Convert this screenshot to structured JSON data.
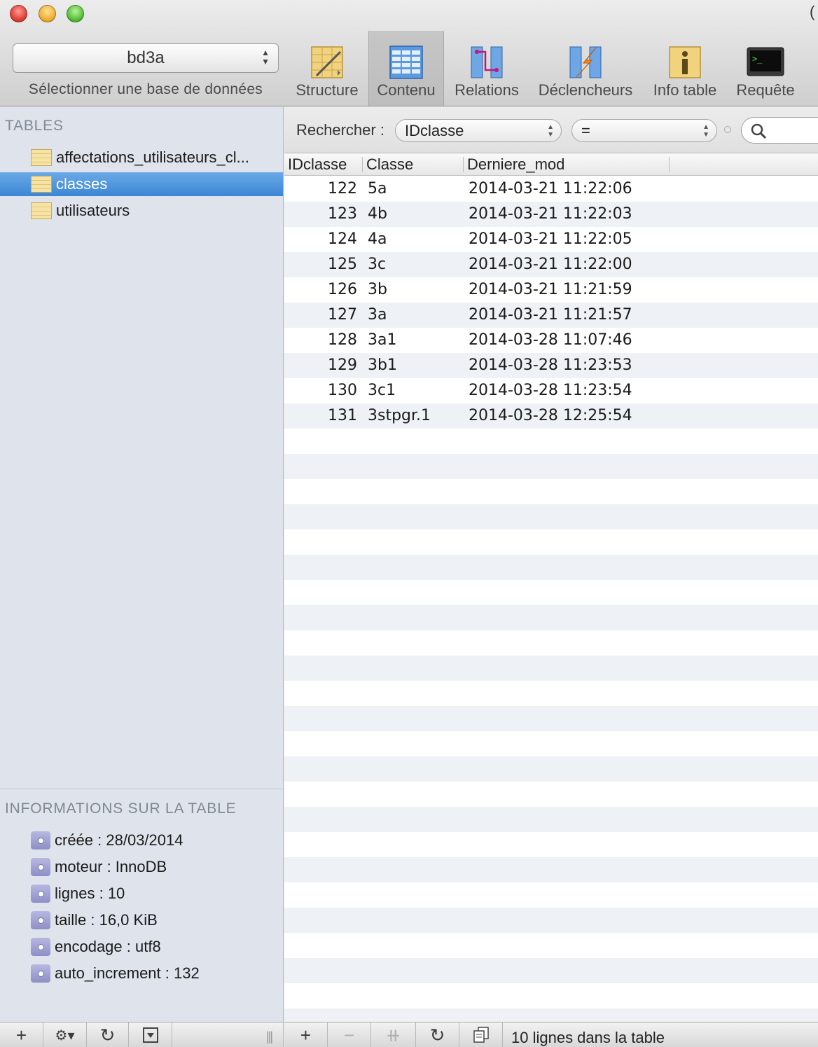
{
  "window": {
    "corner_glyph": "("
  },
  "toolbar": {
    "database_select": {
      "value": "bd3a",
      "label": "Sélectionner une base de données"
    },
    "tools": [
      {
        "label": "Structure",
        "icon": "structure-icon"
      },
      {
        "label": "Contenu",
        "icon": "content-grid-icon",
        "active": true
      },
      {
        "label": "Relations",
        "icon": "relations-icon"
      },
      {
        "label": "Déclencheurs",
        "icon": "triggers-icon"
      },
      {
        "label": "Info table",
        "icon": "info-icon"
      },
      {
        "label": "Requête",
        "icon": "terminal-icon"
      }
    ]
  },
  "sidebar": {
    "tables_title": "TABLES",
    "tables": [
      {
        "label": "affectations_utilisateurs_cl..."
      },
      {
        "label": "classes",
        "selected": true
      },
      {
        "label": "utilisateurs"
      }
    ],
    "info_title": "INFORMATIONS SUR LA TABLE",
    "info": [
      "créée : 28/03/2014",
      "moteur : InnoDB",
      "lignes : 10",
      "taille : 16,0 KiB",
      "encodage : utf8",
      "auto_increment : 132"
    ]
  },
  "filter": {
    "label": "Rechercher :",
    "field": "IDclasse",
    "operator": "="
  },
  "table": {
    "columns": [
      "IDclasse",
      "Classe",
      "Derniere_mod"
    ],
    "rows": [
      [
        "122",
        "5a",
        "2014-03-21 11:22:06"
      ],
      [
        "123",
        "4b",
        "2014-03-21 11:22:03"
      ],
      [
        "124",
        "4a",
        "2014-03-21 11:22:05"
      ],
      [
        "125",
        "3c",
        "2014-03-21 11:22:00"
      ],
      [
        "126",
        "3b",
        "2014-03-21 11:21:59"
      ],
      [
        "127",
        "3a",
        "2014-03-21 11:21:57"
      ],
      [
        "128",
        "3a1",
        "2014-03-28 11:07:46"
      ],
      [
        "129",
        "3b1",
        "2014-03-28 11:23:53"
      ],
      [
        "130",
        "3c1",
        "2014-03-28 11:23:54"
      ],
      [
        "131",
        "3stpgr.1",
        "2014-03-28 12:25:54"
      ]
    ]
  },
  "status": {
    "text": "10 lignes dans la table"
  },
  "colors": {
    "selection": "#3b86d6",
    "sidebar_bg": "#dfe4ec",
    "row_alt": "#eef2f7"
  }
}
